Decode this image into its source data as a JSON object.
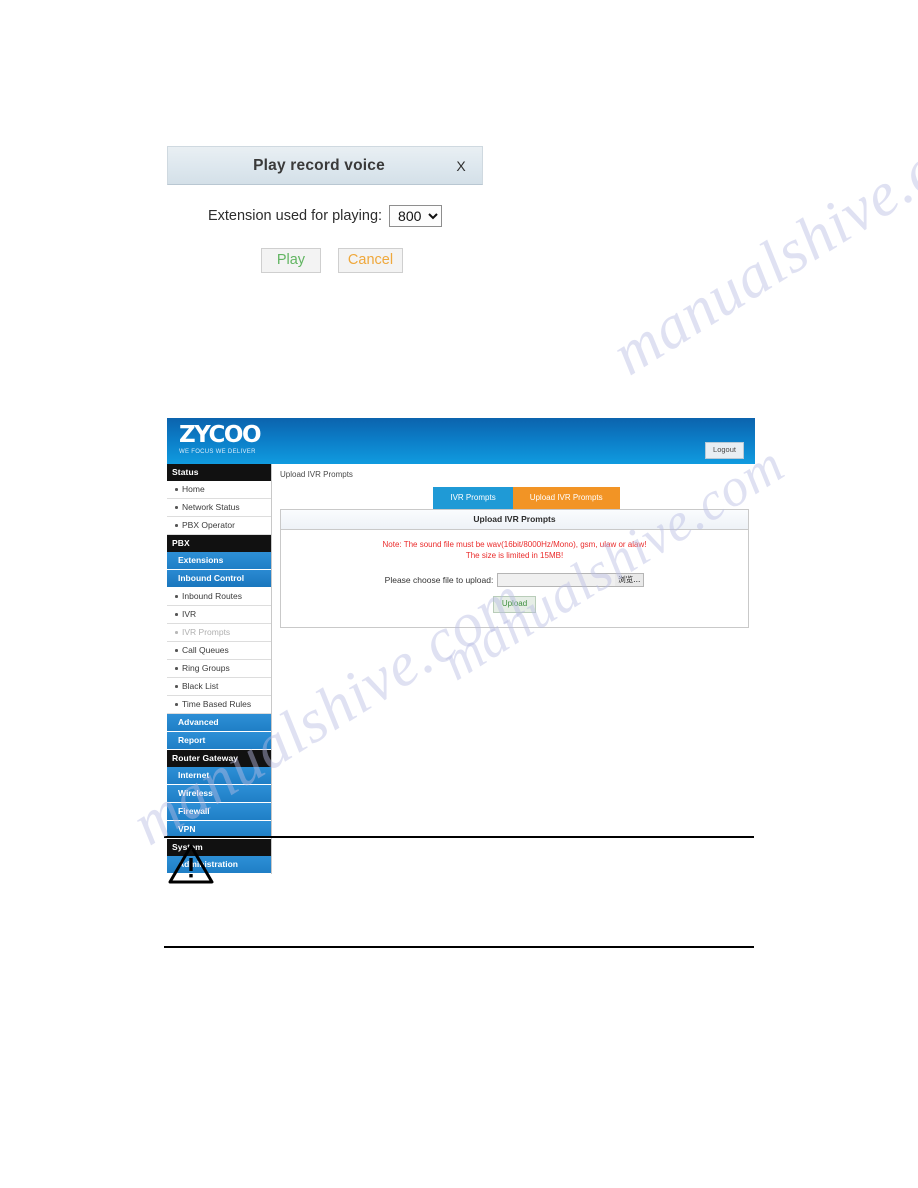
{
  "dialog": {
    "title": "Play record voice",
    "close_label": "X",
    "extension_label": "Extension used for playing:",
    "extension_value": "800",
    "extension_options": [
      "800"
    ],
    "play_label": "Play",
    "cancel_label": "Cancel"
  },
  "pbx": {
    "brand": {
      "name": "ZYCOO",
      "tagline": "WE FOCUS WE DELIVER"
    },
    "logout_label": "Logout",
    "sidebar": [
      {
        "type": "group",
        "label": "Status"
      },
      {
        "type": "item",
        "label": "Home"
      },
      {
        "type": "item",
        "label": "Network Status"
      },
      {
        "type": "item",
        "label": "PBX Operator"
      },
      {
        "type": "group",
        "label": "PBX"
      },
      {
        "type": "blue",
        "label": "Extensions"
      },
      {
        "type": "blue-active",
        "label": "Inbound Control"
      },
      {
        "type": "item",
        "label": "Inbound Routes"
      },
      {
        "type": "item",
        "label": "IVR"
      },
      {
        "type": "item-dim",
        "label": "IVR Prompts"
      },
      {
        "type": "item",
        "label": "Call Queues"
      },
      {
        "type": "item",
        "label": "Ring Groups"
      },
      {
        "type": "item",
        "label": "Black List"
      },
      {
        "type": "item",
        "label": "Time Based Rules"
      },
      {
        "type": "blue",
        "label": "Advanced"
      },
      {
        "type": "blue",
        "label": "Report"
      },
      {
        "type": "group",
        "label": "Router Gateway"
      },
      {
        "type": "blue",
        "label": "Internet"
      },
      {
        "type": "blue",
        "label": "Wireless"
      },
      {
        "type": "blue",
        "label": "Firewall"
      },
      {
        "type": "blue",
        "label": "VPN"
      },
      {
        "type": "group",
        "label": "System"
      },
      {
        "type": "blue",
        "label": "Administration"
      }
    ],
    "breadcrumb": "Upload IVR Prompts",
    "tabs": [
      {
        "label": "IVR Prompts",
        "active": false
      },
      {
        "label": "Upload IVR Prompts",
        "active": true
      }
    ],
    "panel": {
      "title": "Upload IVR Prompts",
      "note_line1": "Note: The sound file must be wav(16bit/8000Hz/Mono), gsm, ulaw or alaw!",
      "note_line2": "The size is limited in 15MB!",
      "upload_label": "Please choose file to upload:",
      "file_value": "",
      "browse_label": "浏览...",
      "upload_button": "Upload"
    },
    "colors": {
      "header_top": "#0c63ad",
      "header_bottom": "#109bdf",
      "tab_inactive": "#1f9ad6",
      "tab_active": "#f29425",
      "note_red": "#ea2b2b",
      "nav_group_bg": "#111111",
      "nav_blue_bg": "#2d8fd6"
    }
  },
  "watermarks": [
    "manualshive.com",
    "manualshive.com",
    "manualshive.com"
  ]
}
